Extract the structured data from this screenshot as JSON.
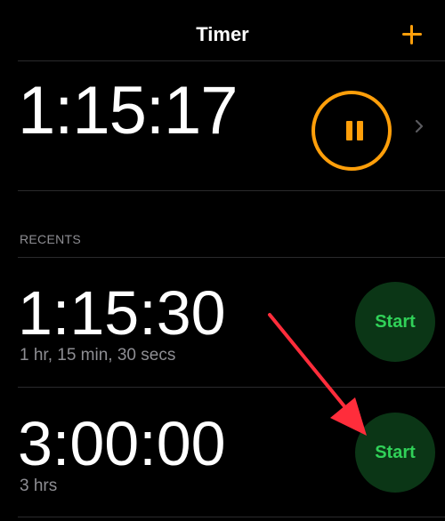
{
  "header": {
    "title": "Timer",
    "add_icon": "plus-icon"
  },
  "active_timer": {
    "time": "1:15:17",
    "pause_icon": "pause-icon",
    "chevron_icon": "chevron-right-icon"
  },
  "recents": {
    "label": "RECENTS",
    "items": [
      {
        "time": "1:15:30",
        "subtitle": "1 hr, 15 min, 30 secs",
        "start_label": "Start"
      },
      {
        "time": "3:00:00",
        "subtitle": "3 hrs",
        "start_label": "Start"
      }
    ]
  },
  "colors": {
    "accent_orange": "#ff9f0a",
    "start_green": "#30d158",
    "start_bg": "#0b3616",
    "annotation_red": "#ff2d3b"
  }
}
